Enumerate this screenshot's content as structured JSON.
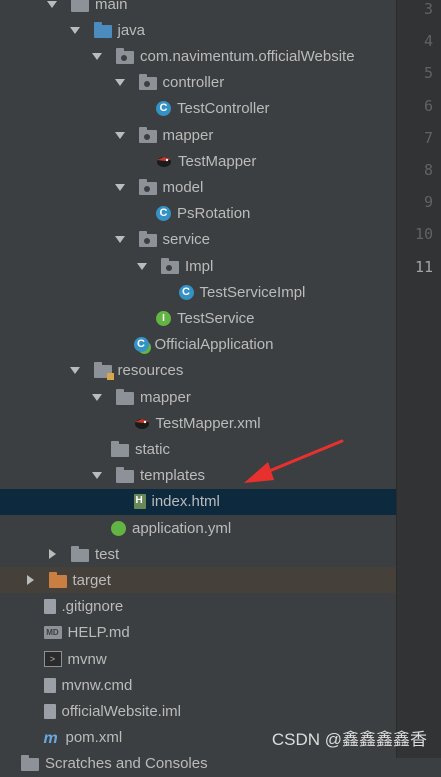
{
  "tree": {
    "rows": [
      {
        "label": "main",
        "icon": "folder-icon",
        "depth": 2,
        "arrow": "down"
      },
      {
        "label": "java",
        "icon": "source-folder-icon",
        "depth": 3,
        "arrow": "down"
      },
      {
        "label": "com.navimentum.officialWebsite",
        "icon": "package-icon",
        "depth": 4,
        "arrow": "down"
      },
      {
        "label": "controller",
        "icon": "package-icon",
        "depth": 5,
        "arrow": "down"
      },
      {
        "label": "TestController",
        "icon": "class-icon",
        "depth": 6
      },
      {
        "label": "mapper",
        "icon": "package-icon",
        "depth": 5,
        "arrow": "down"
      },
      {
        "label": "TestMapper",
        "icon": "mybatis-bird-icon",
        "depth": 6
      },
      {
        "label": "model",
        "icon": "package-icon",
        "depth": 5,
        "arrow": "down"
      },
      {
        "label": "PsRotation",
        "icon": "class-icon",
        "depth": 6
      },
      {
        "label": "service",
        "icon": "package-icon",
        "depth": 5,
        "arrow": "down"
      },
      {
        "label": "Impl",
        "icon": "package-icon",
        "depth": 6,
        "arrow": "down"
      },
      {
        "label": "TestServiceImpl",
        "icon": "class-icon",
        "depth": 7
      },
      {
        "label": "TestService",
        "icon": "interface-icon",
        "depth": 6
      },
      {
        "label": "OfficialApplication",
        "icon": "spring-class-icon",
        "depth": 5
      },
      {
        "label": "resources",
        "icon": "resources-folder-icon",
        "depth": 3,
        "arrow": "down"
      },
      {
        "label": "mapper",
        "icon": "folder-icon",
        "depth": 4,
        "arrow": "down"
      },
      {
        "label": "TestMapper.xml",
        "icon": "mybatis-bird-icon",
        "depth": 5
      },
      {
        "label": "static",
        "icon": "folder-icon",
        "depth": 4
      },
      {
        "label": "templates",
        "icon": "folder-icon",
        "depth": 4,
        "arrow": "down"
      },
      {
        "label": "index.html",
        "icon": "html-file-icon",
        "depth": 5,
        "selected": true
      },
      {
        "label": "application.yml",
        "icon": "spring-config-icon",
        "depth": 4
      },
      {
        "label": "test",
        "icon": "folder-icon",
        "depth": 2,
        "arrow": "right"
      },
      {
        "label": "target",
        "icon": "excluded-folder-icon",
        "depth": 1,
        "arrow": "right",
        "highlight": true
      },
      {
        "label": ".gitignore",
        "icon": "text-file-icon",
        "depth": 1
      },
      {
        "label": "HELP.md",
        "icon": "markdown-file-icon",
        "depth": 1
      },
      {
        "label": "mvnw",
        "icon": "terminal-file-icon",
        "depth": 1
      },
      {
        "label": "mvnw.cmd",
        "icon": "text-file-icon",
        "depth": 1
      },
      {
        "label": "officialWebsite.iml",
        "icon": "text-file-icon",
        "depth": 1
      },
      {
        "label": "pom.xml",
        "icon": "maven-icon",
        "depth": 1
      },
      {
        "label": "Scratches and Consoles",
        "icon": "scratches-icon",
        "depth": 0
      }
    ]
  },
  "gutter": {
    "lines": [
      "3",
      "4",
      "5",
      "6",
      "7",
      "8",
      "9",
      "10",
      "11"
    ],
    "current": "11"
  },
  "watermark": "CSDN @鑫鑫鑫鑫香",
  "colors": {
    "background": "#3c3f41",
    "selection": "#0d293e",
    "annotation_arrow": "#e8312f"
  }
}
